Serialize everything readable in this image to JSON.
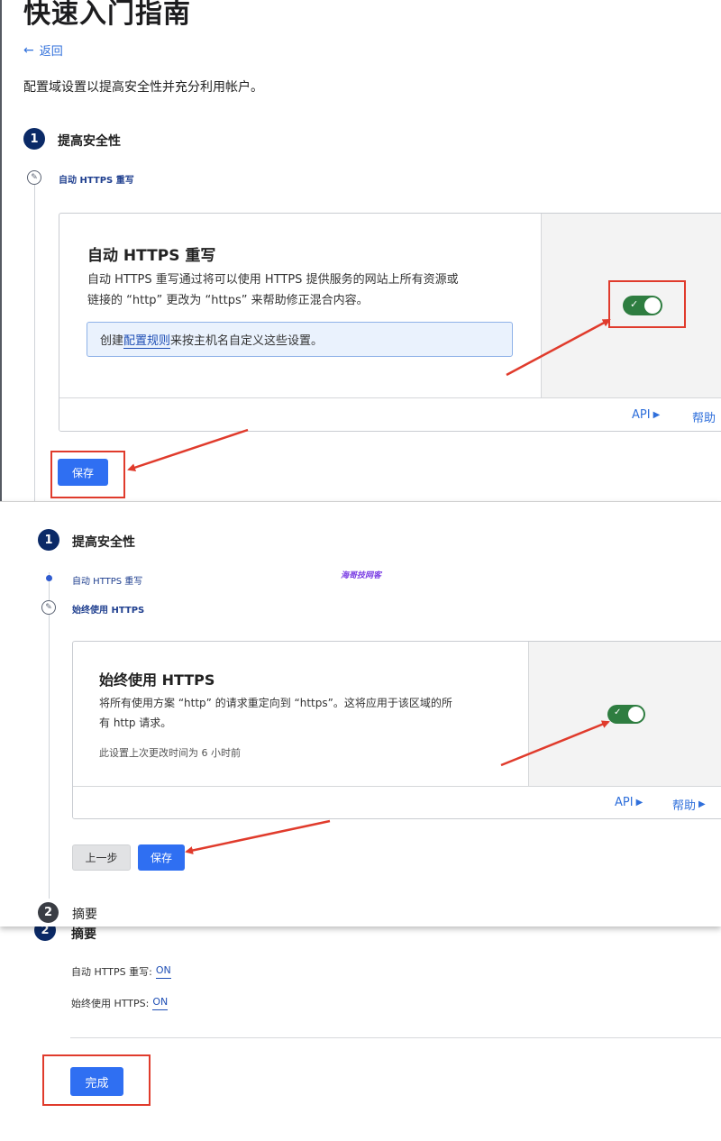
{
  "header": {
    "title": "快速入门指南",
    "back_label": "返回",
    "intro": "配置域设置以提高安全性并充分利用帐户。"
  },
  "steps": {
    "step1_num": "1",
    "step1_title": "提高安全性",
    "step2_num": "2",
    "step2_title": "摘要"
  },
  "panel1": {
    "sub_label": "自动 HTTPS 重写",
    "card_title": "自动 HTTPS 重写",
    "card_desc_line1": "自动 HTTPS 重写通过将可以使用 HTTPS 提供服务的网站上所有资源或",
    "card_desc_line2": "链接的 “http” 更改为 “https” 来帮助修正混合内容。",
    "info_prefix": "创建",
    "info_link": "配置规则",
    "info_suffix": "来按主机名自定义这些设置。",
    "api_label": "API",
    "help_label": "帮助",
    "save_label": "保存",
    "toggle_on": true
  },
  "panel2": {
    "sub_label_done": "自动 HTTPS 重写",
    "sub_label_current": "始终使用 HTTPS",
    "watermark": "海哥技网客",
    "card_title": "始终使用 HTTPS",
    "card_desc_line1": "将所有使用方案 “http” 的请求重定向到 “https”。这将应用于该区域的所",
    "card_desc_line2": "有 http 请求。",
    "card_note": "此设置上次更改时间为 6 小时前",
    "api_label": "API",
    "help_label": "帮助",
    "prev_label": "上一步",
    "save_label": "保存",
    "toggle_on": true
  },
  "summary": {
    "row1_label": "自动 HTTPS 重写:",
    "row1_value": "ON",
    "row2_label": "始终使用 HTTPS:",
    "row2_value": "ON",
    "done_label": "完成"
  },
  "colors": {
    "accent": "#2f6ff2",
    "step_badge": "#0b2a67",
    "toggle_on": "#2e7d40",
    "annotation_red": "#e03b2c"
  }
}
